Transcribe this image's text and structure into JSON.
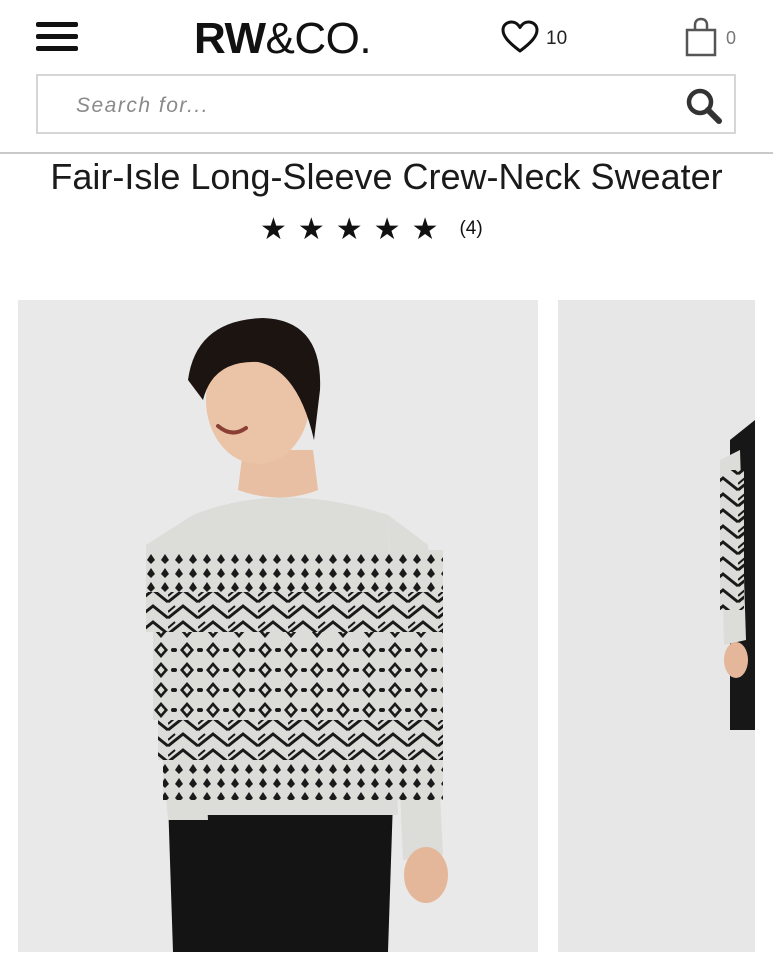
{
  "header": {
    "brand_bold": "RW",
    "brand_rest": "&CO.",
    "wishlist_count": "10",
    "bag_count": "0",
    "icons": [
      "menu-icon",
      "heart-icon",
      "shopping-bag-icon",
      "search-icon"
    ]
  },
  "search": {
    "placeholder": "Search for..."
  },
  "product": {
    "title": "Fair-Isle Long-Sleeve Crew-Neck Sweater",
    "stars": "★★★★★",
    "rating": 5,
    "review_count": "(4)"
  },
  "gallery": {
    "images": [
      "product-image-front",
      "product-image-side"
    ]
  },
  "colors": {
    "text": "#111111",
    "background": "#ffffff",
    "photo_bg": "#e9e9e9",
    "sweater": "#dcdcd8",
    "pattern": "#1a1a1a"
  }
}
